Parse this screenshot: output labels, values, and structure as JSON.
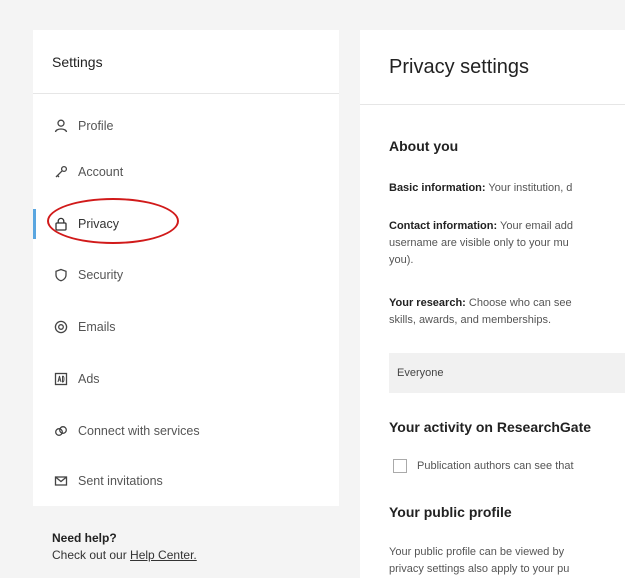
{
  "sidebar": {
    "title": "Settings",
    "items": [
      {
        "label": "Profile",
        "icon": "person-icon"
      },
      {
        "label": "Account",
        "icon": "key-icon"
      },
      {
        "label": "Privacy",
        "icon": "lock-icon"
      },
      {
        "label": "Security",
        "icon": "shield-icon"
      },
      {
        "label": "Emails",
        "icon": "at-icon"
      },
      {
        "label": "Ads",
        "icon": "ads-icon"
      },
      {
        "label": "Connect with services",
        "icon": "link-icon"
      },
      {
        "label": "Sent invitations",
        "icon": "envelope-icon"
      }
    ],
    "active": "Privacy"
  },
  "help": {
    "title": "Need help?",
    "prefix": "Check out our ",
    "link": "Help Center."
  },
  "main": {
    "title": "Privacy settings",
    "about_title": "About you",
    "basic_label": "Basic information:",
    "basic_text": " Your institution, d",
    "contact_label": "Contact information:",
    "contact_text": " Your email add",
    "contact_line2": "username are visible only to your mu",
    "contact_line3": "you).",
    "research_label": "Your research:",
    "research_text": " Choose who can see",
    "research_line2": "skills, awards, and memberships.",
    "select_value": "Everyone",
    "activity_title": "Your activity on ResearchGate",
    "checkbox_label": "Publication authors can see that",
    "public_title": "Your public profile",
    "public_line1": "Your public profile can be viewed by",
    "public_line2": "privacy settings also apply to your pu"
  },
  "colors": {
    "active_bar": "#5aa6e0",
    "annotation": "#d11a1a"
  }
}
